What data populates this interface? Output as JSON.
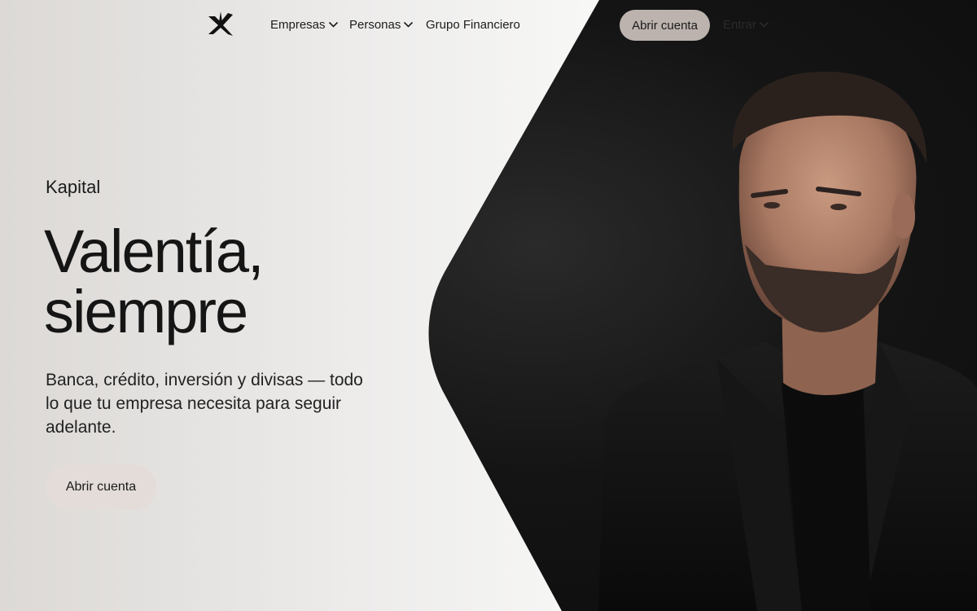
{
  "nav": {
    "brand_icon": "kapital-star-logo",
    "items": [
      {
        "label": "Empresas",
        "has_dropdown": true
      },
      {
        "label": "Personas",
        "has_dropdown": true
      },
      {
        "label": "Grupo Financiero",
        "has_dropdown": false
      }
    ],
    "cta_label": "Abrir cuenta",
    "secondary_label": "Entrar",
    "cta_color": "#bcb3ae"
  },
  "hero": {
    "eyebrow": "Kapital",
    "title_line1": "Valentía,",
    "title_line2": "siempre",
    "subtitle": "Banca, crédito, inversión y divisas — todo lo que tu empresa necesita para seguir adelante.",
    "cta_label": "Abrir cuenta",
    "cta_color": "#e3dcd8"
  },
  "image": {
    "subject": "hero-portrait"
  },
  "colors": {
    "dark_panel": "#0f0f0f",
    "text": "#151515"
  }
}
